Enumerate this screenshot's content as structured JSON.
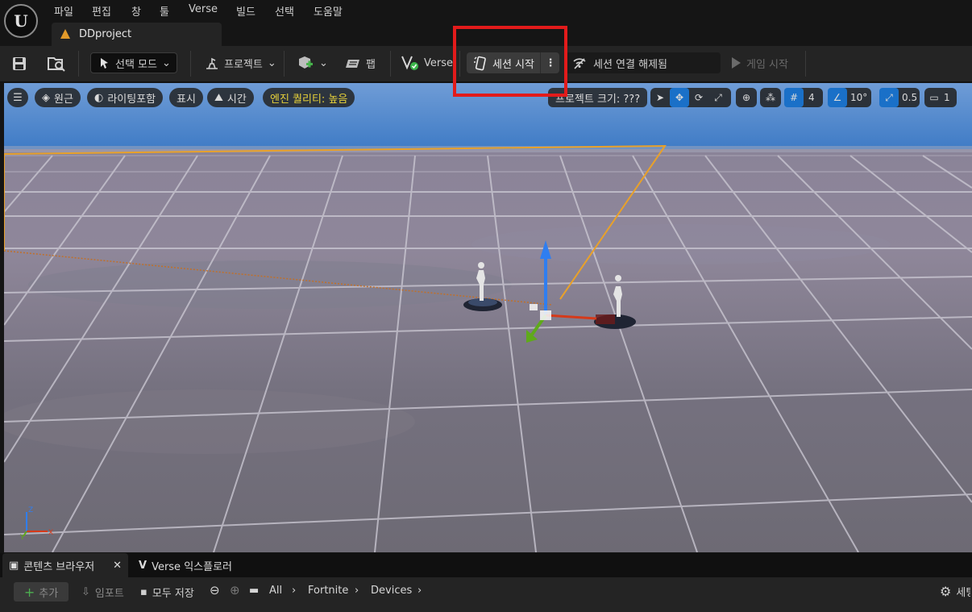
{
  "menu": [
    "파일",
    "편집",
    "창",
    "툴",
    "Verse",
    "빌드",
    "선택",
    "도움말"
  ],
  "document_tab": {
    "label": "DDproject"
  },
  "toolbar": {
    "selection_mode": "선택 모드",
    "project": "프로젝트",
    "map": "팹",
    "verse": "Verse",
    "session_start": "세션 시작",
    "session_status": "세션 연결 해제됨",
    "game_start": "게임 시작"
  },
  "viewport": {
    "perspective": "원근",
    "lighting": "라이팅포함",
    "show": "표시",
    "time": "시간",
    "engine_quality": "엔진 퀄리티: 높음",
    "project_size": "프로젝트 크기: ???",
    "grid_snap": "4",
    "rotation_snap": "10°",
    "scale_snap": "0.5",
    "camera_speed": "1",
    "axis_labels": {
      "z": "Z",
      "x": "X",
      "y": "Y"
    }
  },
  "bottom_tabs": {
    "content_browser": "콘텐츠 브라우저",
    "verse_explorer": "Verse 익스플로러"
  },
  "content_browser": {
    "add": "추가",
    "import": "임포트",
    "save_all": "모두 저장",
    "path": [
      "All",
      "Fortnite",
      "Devices"
    ],
    "settings_label": "세팅"
  },
  "colors": {
    "accent": "#1a70c8",
    "highlight": "#e21b1b",
    "selection": "#e8a12a",
    "engine_quality": "#e7d23a"
  }
}
